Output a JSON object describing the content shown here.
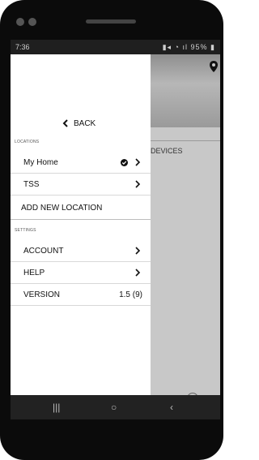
{
  "status_bar": {
    "time": "7:36",
    "battery": "95%"
  },
  "drawer": {
    "back_label": "BACK",
    "locations_label": "LOCATIONS",
    "locations": [
      {
        "label": "My Home"
      },
      {
        "label": "TSS"
      }
    ],
    "add_location_label": "ADD NEW LOCATION",
    "settings_label": "SETTINGS",
    "settings": [
      {
        "label": "ACCOUNT"
      },
      {
        "label": "HELP"
      }
    ],
    "version_label": "VERSION",
    "version_value": "1.5 (9)"
  },
  "background": {
    "devices_label": "DEVICES"
  }
}
